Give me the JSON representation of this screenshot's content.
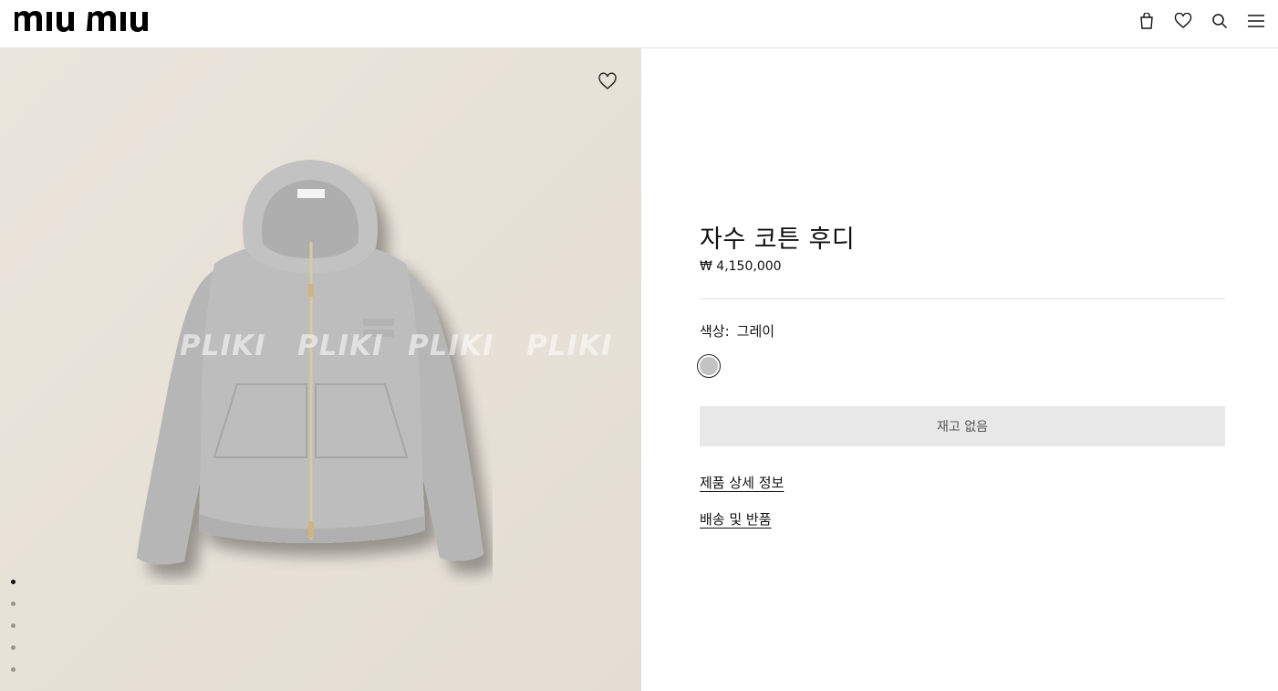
{
  "header": {
    "logo_text": "miu miu",
    "icons": [
      "shopping-bag-icon",
      "heart-icon",
      "search-icon",
      "menu-icon"
    ]
  },
  "gallery": {
    "watermark": [
      "PLIKI",
      "PLIKI",
      "PLIKI",
      "PLIKI"
    ],
    "slide_count": 5,
    "active_slide": 1,
    "product_color": "#bdbdbd"
  },
  "product": {
    "title": "자수 코튼 후디",
    "price": "₩ 4,150,000",
    "color_label": "색상:",
    "color_value": "그레이",
    "swatch_color": "#c3c3c3",
    "out_of_stock_label": "재고 없음",
    "details_link": "제품 상세 정보",
    "shipping_link": "배송 및 반품"
  }
}
